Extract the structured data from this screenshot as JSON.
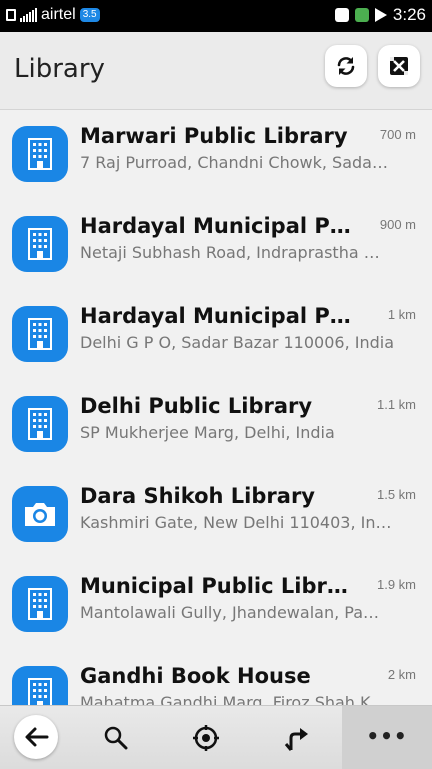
{
  "status": {
    "carrier": "airtel",
    "network": "3.5",
    "time": "3:26"
  },
  "header": {
    "title": "Library",
    "refresh_icon": "refresh-icon",
    "close_icon": "close-map-icon"
  },
  "items": [
    {
      "name": "Marwari Public Library",
      "address": "7 Raj Purroad, Chandni Chowk, Sada…",
      "distance": "700 m",
      "icon": "building-icon"
    },
    {
      "name": "Hardayal Municipal Pub…",
      "address": "Netaji Subhash Road, Indraprastha …",
      "distance": "900 m",
      "icon": "building-icon"
    },
    {
      "name": "Hardayal Municipal Publi…",
      "address": "Delhi G P O, Sadar Bazar 110006, India",
      "distance": "1 km",
      "icon": "building-icon"
    },
    {
      "name": "Delhi Public Library",
      "address": "SP Mukherjee Marg, Delhi, India",
      "distance": "1.1 km",
      "icon": "building-icon"
    },
    {
      "name": "Dara Shikoh Library",
      "address": "Kashmiri Gate, New Delhi 110403, In…",
      "distance": "1.5 km",
      "icon": "camera-icon"
    },
    {
      "name": "Municipal Public Library",
      "address": "Mantolawali Gully, Jhandewalan, Pa…",
      "distance": "1.9 km",
      "icon": "building-icon"
    },
    {
      "name": "Gandhi Book House",
      "address": "Mahatma Gandhi Marg, Firoz Shah K…",
      "distance": "2 km",
      "icon": "building-icon"
    }
  ],
  "toolbar": {
    "back": "back-arrow-icon",
    "search": "search-icon",
    "locate": "locate-icon",
    "navigate": "navigate-icon",
    "more_label": "•••"
  },
  "colors": {
    "accent": "#1a86e5",
    "header_bg": "#ebebeb",
    "list_bg": "#f1f1f1"
  }
}
